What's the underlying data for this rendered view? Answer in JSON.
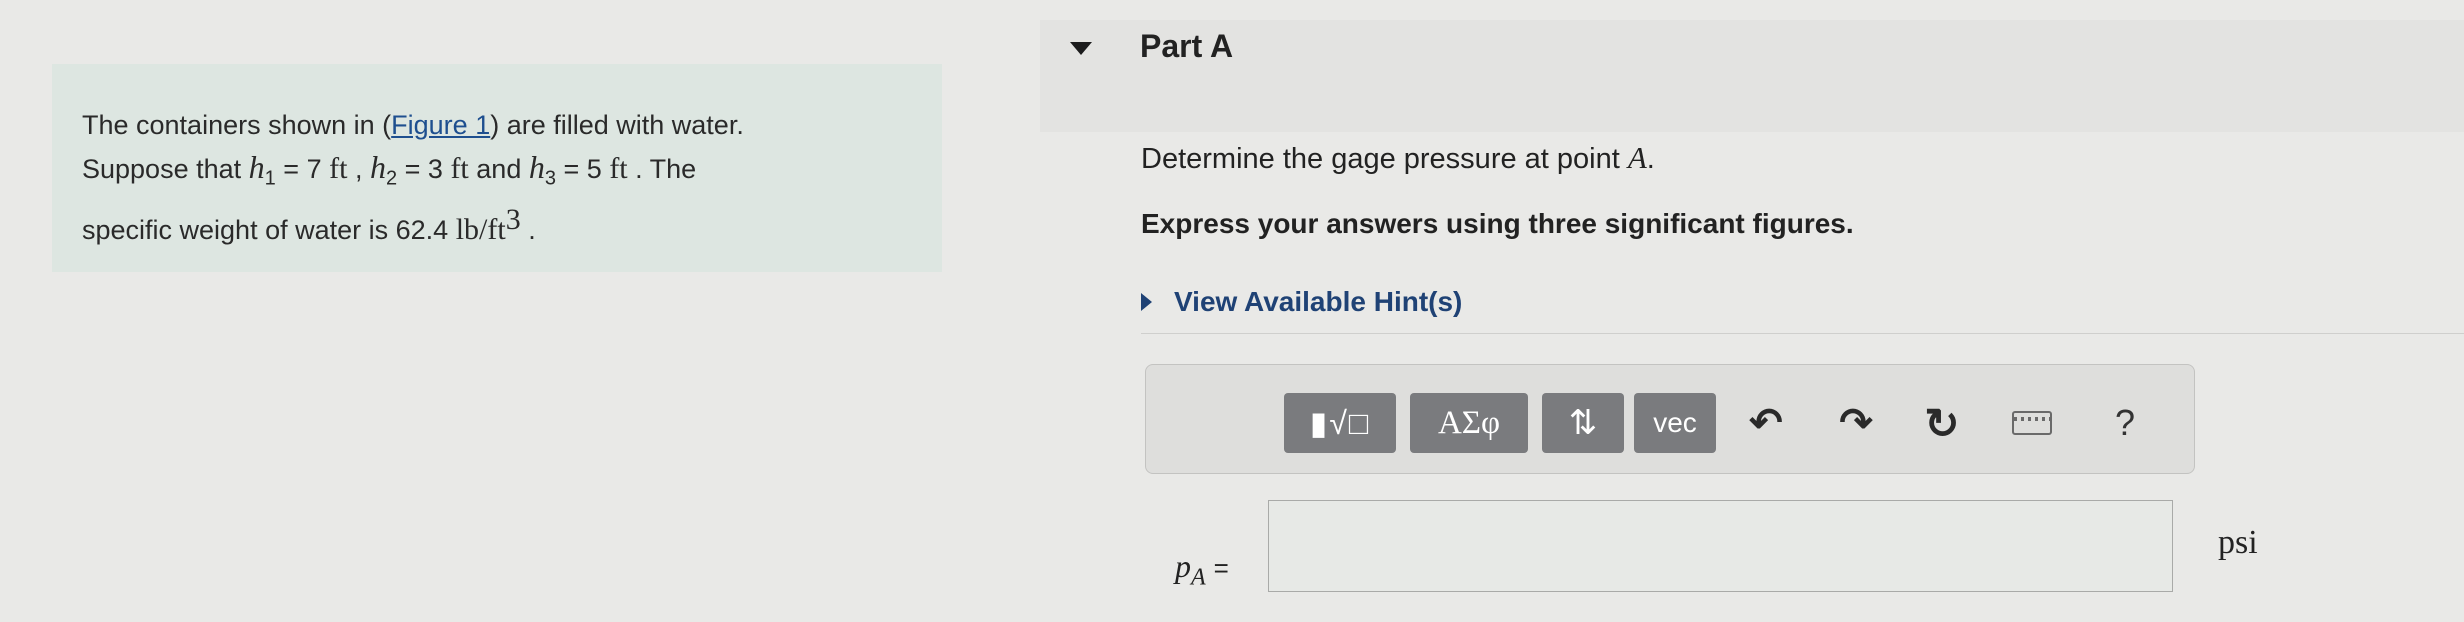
{
  "problem": {
    "text_1": "The containers shown in (",
    "figure_link": "Figure 1",
    "text_2": ") are filled with water.",
    "text_3": "Suppose that",
    "h1_var": "h",
    "h1_sub": "1",
    "h1_val": "= 7",
    "h1_unit": "ft",
    "sep1": ",",
    "h2_var": "h",
    "h2_sub": "2",
    "h2_val": "= 3",
    "h2_unit": "ft",
    "and": "and",
    "h3_var": "h",
    "h3_sub": "3",
    "h3_val": "= 5",
    "h3_unit": "ft",
    "text_4": ". The",
    "text_5": "specific weight of water is 62.4",
    "weight_unit": "lb/ft",
    "weight_exp": "3",
    "text_6": "."
  },
  "part": {
    "title": "Part A"
  },
  "question": {
    "text": "Determine the gage pressure at point",
    "point": "A",
    "end": "."
  },
  "instruction": "Express your answers using three significant figures.",
  "hint_label": "View Available Hint(s)",
  "toolbar": {
    "templates_label": "▮√□",
    "greek_label": "ΑΣφ",
    "arrows_label": "⇅",
    "vec_label": "vec",
    "undo_glyph": "↶",
    "redo_glyph": "↷",
    "reset_glyph": "↻",
    "help_label": "?"
  },
  "answer": {
    "var": "p",
    "sub": "A",
    "equals": "=",
    "value": "",
    "unit": "psi"
  },
  "colors": {
    "panel_bg": "#dde6e1",
    "link": "#1e4f8f",
    "hint": "#1f4275",
    "button": "#7a7b7e"
  }
}
